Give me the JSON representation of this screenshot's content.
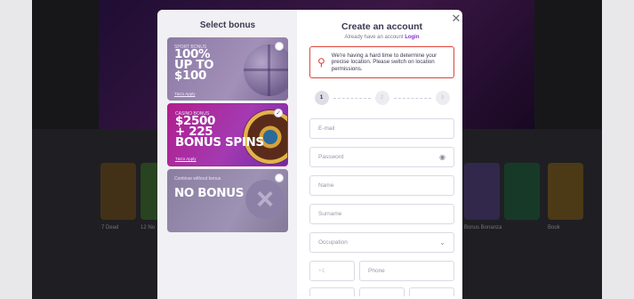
{
  "background": {
    "cards": [
      {
        "color": "#7a5a2a"
      },
      {
        "color": "#4a7a3a"
      },
      {
        "color": "#5a4a8a"
      },
      {
        "color": "#2a6a4a"
      },
      {
        "color": "#8a6a2a"
      }
    ],
    "captions": [
      "7 Dead",
      "12 No",
      "Bonus Bonanza",
      "Book"
    ]
  },
  "left": {
    "title": "Select bonus",
    "bonuses": [
      {
        "small": "SPORT BONUS",
        "big": [
          "100%",
          "UP TO",
          "$100"
        ],
        "tc": "T&Cs Apply",
        "selected": false
      },
      {
        "small": "CASINO BONUS",
        "big": [
          "$2500",
          "+ 225",
          "BONUS SPINS"
        ],
        "tc": "T&Cs Apply",
        "selected": true
      },
      {
        "small": "Continue without bonus",
        "big": [
          "NO BONUS"
        ],
        "tc": "",
        "selected": false
      }
    ],
    "check_glyph": "✓"
  },
  "right": {
    "title": "Create an account",
    "have_account": "Already have an account",
    "login_link": "Login",
    "alert": {
      "icon": "location-pin-icon",
      "text": "We're having a hard time to determine your precise location. Please switch on location permissions."
    },
    "steps": [
      "1",
      "2",
      "3"
    ],
    "fields": {
      "email": "E-mail",
      "password": "Password",
      "name": "Name",
      "surname": "Surname",
      "occupation": "Occupation",
      "code": "+1",
      "phone": "Phone"
    },
    "close_glyph": "✕",
    "eye_glyph": "👁",
    "chevron_glyph": "⌄"
  },
  "colors": {
    "accent": "#8a2bd6",
    "alert": "#e0433d",
    "casino_bonus": "#b01e8e"
  }
}
